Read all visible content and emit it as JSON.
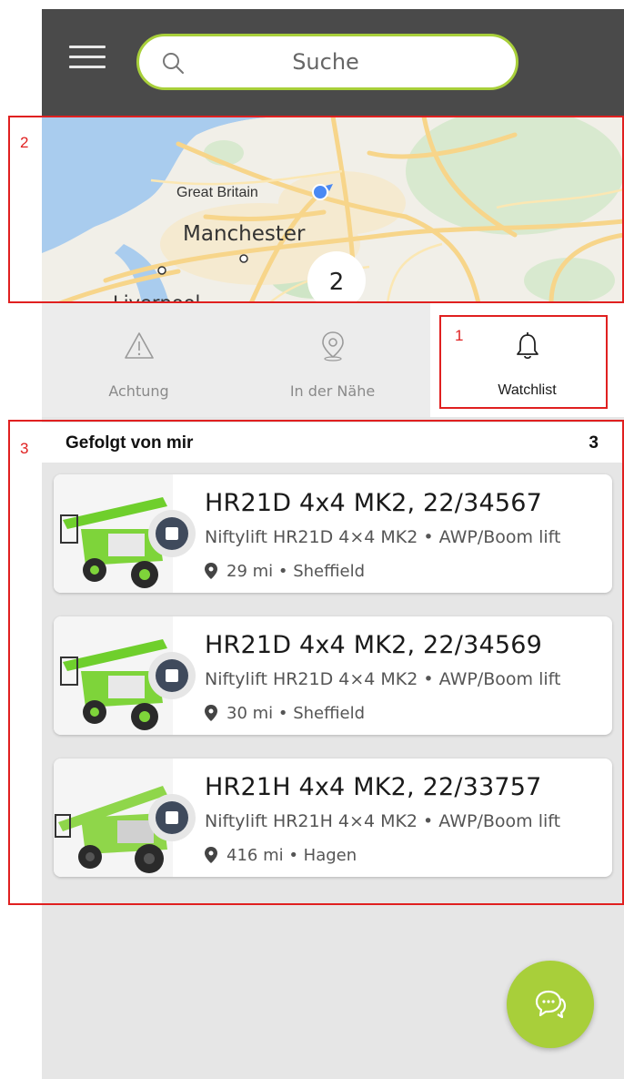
{
  "search": {
    "placeholder": "Suche"
  },
  "map": {
    "labels": {
      "great_britain": "Great Britain",
      "manchester": "Manchester",
      "liverpool": "Liverpool"
    },
    "cluster_count": "2"
  },
  "tabs": [
    {
      "label": "Achtung",
      "icon": "warning-icon",
      "active": false
    },
    {
      "label": "In der Nähe",
      "icon": "location-pin-icon",
      "active": false
    },
    {
      "label": "Watchlist",
      "icon": "bell-icon",
      "active": true
    }
  ],
  "list": {
    "title": "Gefolgt von mir",
    "count": "3",
    "items": [
      {
        "title": "HR21D 4x4 MK2, 22/34567",
        "subtitle": "Niftylift HR21D 4×4 MK2 • AWP/Boom lift",
        "location": "29 mi • Sheffield"
      },
      {
        "title": "HR21D 4x4 MK2, 22/34569",
        "subtitle": "Niftylift HR21D 4×4 MK2 • AWP/Boom lift",
        "location": "30 mi • Sheffield"
      },
      {
        "title": "HR21H 4x4 MK2, 22/33757",
        "subtitle": "Niftylift HR21H 4×4 MK2 • AWP/Boom lift",
        "location": "416 mi • Hagen"
      }
    ]
  },
  "annotations": [
    "1",
    "2",
    "3"
  ],
  "colors": {
    "accent": "#a8cf3a",
    "header": "#4a4a4a",
    "annotation": "#e02020",
    "stop_button": "#3f4a5c"
  }
}
